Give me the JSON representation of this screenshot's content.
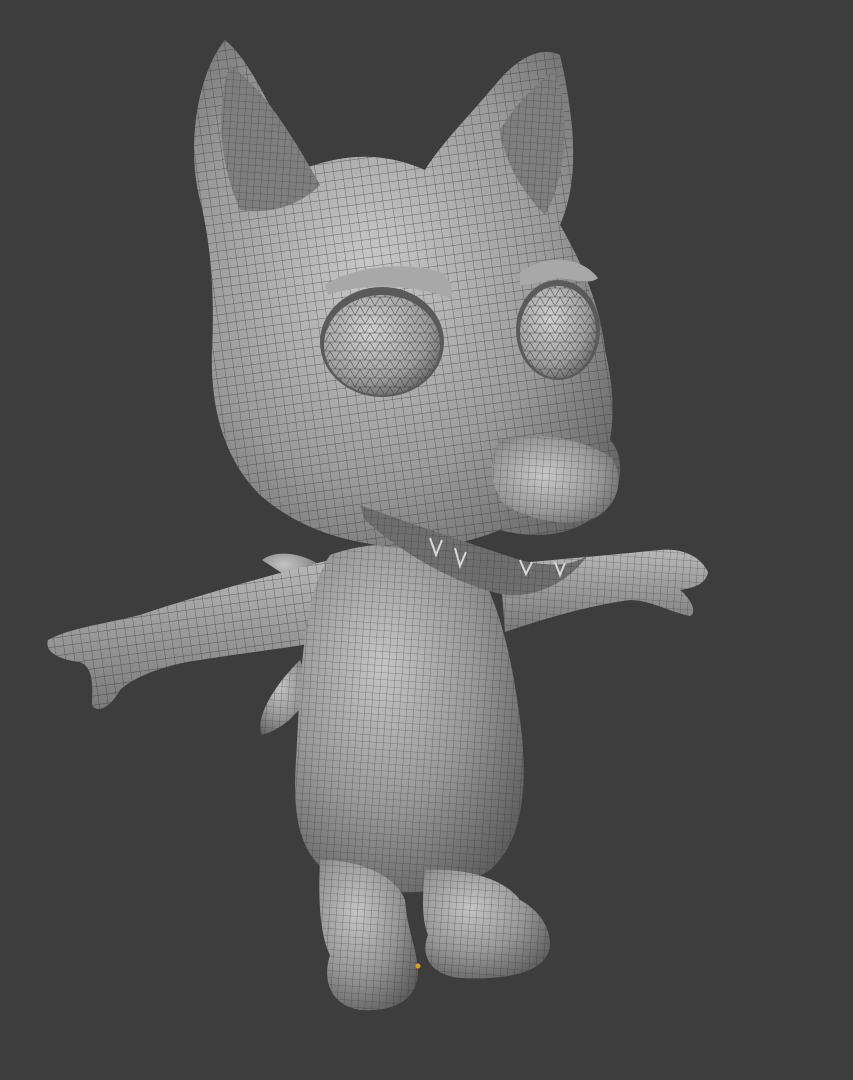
{
  "viewport": {
    "background_color": "#3d3d3d",
    "mesh_color": "#8f8f8f",
    "mesh_shadow_color": "#5e5e5e",
    "mesh_highlight_color": "#c4c4c4",
    "wire_color": "#2a2a2a",
    "origin_color": "#e0a020"
  },
  "model": {
    "subject": "cartoon-wolf-character",
    "pose": "t-pose",
    "display_mode": "solid-with-wireframe"
  }
}
